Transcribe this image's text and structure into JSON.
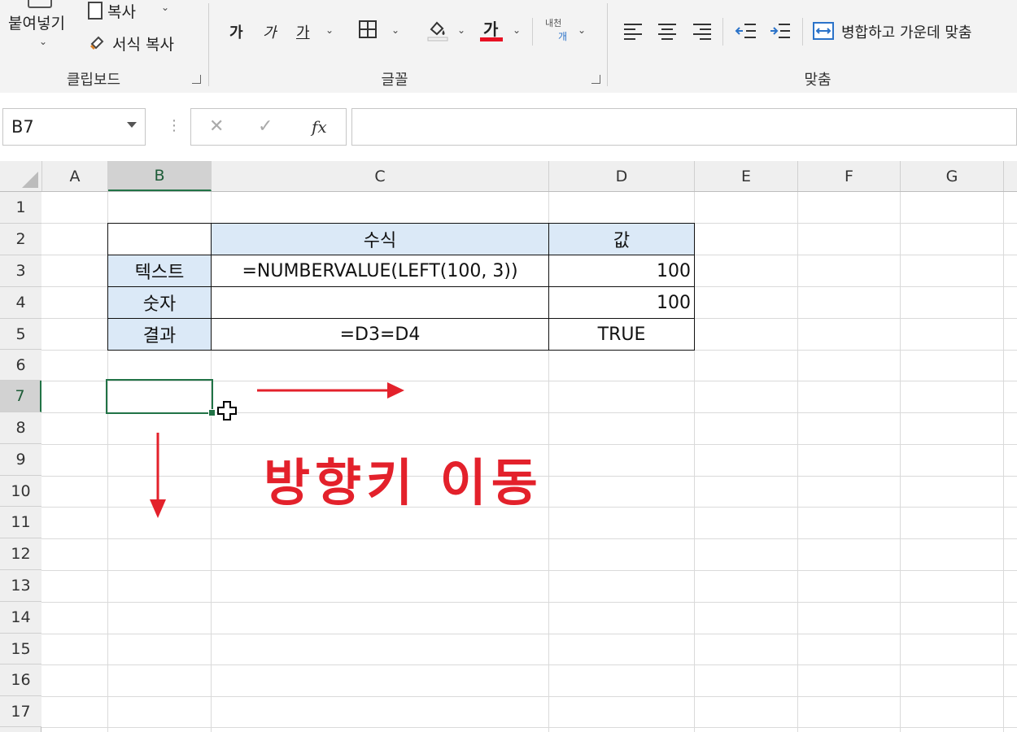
{
  "ribbon": {
    "clipboard": {
      "paste_label": "붙여넣기",
      "copy_label": "복사",
      "format_painter_label": "서식 복사",
      "group_label": "클립보드"
    },
    "font": {
      "increase_font": "가",
      "decrease_font": "가",
      "underline": "가",
      "font_color_glyph": "가",
      "phonetic_top": "내천",
      "phonetic_bottom": "개",
      "group_label": "글꼴",
      "font_color": "#e81123"
    },
    "alignment": {
      "merge_center_label": "병합하고 가운데 맞춤",
      "group_label": "맞춤"
    }
  },
  "formula_bar": {
    "name_box": "B7",
    "cancel_symbol": "✕",
    "enter_symbol": "✓",
    "fx_symbol": "fx",
    "formula_value": ""
  },
  "sheet": {
    "columns": [
      "A",
      "B",
      "C",
      "D",
      "E",
      "F",
      "G"
    ],
    "rows": [
      "1",
      "2",
      "3",
      "4",
      "5",
      "6",
      "7",
      "8",
      "9",
      "10",
      "11",
      "12",
      "13",
      "14",
      "15",
      "16",
      "17"
    ],
    "selected_column": "B",
    "selected_row": "7",
    "active_cell": "B7",
    "table": {
      "header_formula": "수식",
      "header_value": "값",
      "row3_label": "텍스트",
      "row3_formula": "=NUMBERVALUE(LEFT(100, 3))",
      "row3_value": "100",
      "row4_label": "숫자",
      "row4_formula": "",
      "row4_value": "100",
      "row5_label": "결과",
      "row5_formula": "=D3=D4",
      "row5_value": "TRUE"
    }
  },
  "annotation": {
    "text": "방향키 이동",
    "color": "#e3212b"
  },
  "colors": {
    "header_fill": "#dbe9f7",
    "selection_green": "#217346"
  }
}
